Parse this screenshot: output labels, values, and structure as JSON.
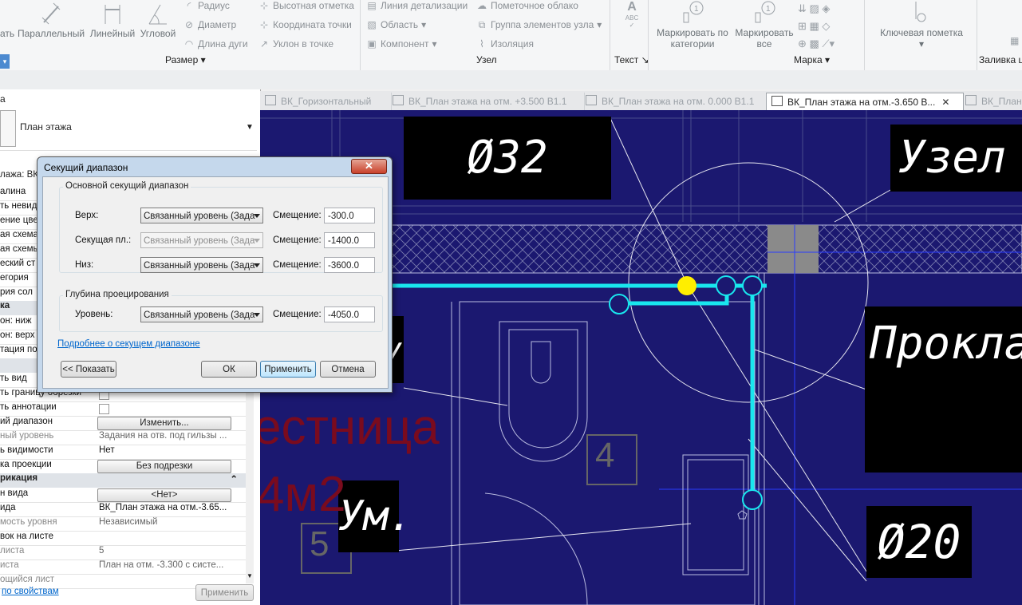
{
  "ribbon": {
    "dim_buttons": [
      {
        "label": "ать"
      },
      {
        "label": "Параллельный"
      },
      {
        "label": "Линейный"
      },
      {
        "label": "Угловой"
      }
    ],
    "dim_small": [
      "Радиус",
      "Диаметр",
      "Длина дуги"
    ],
    "spot_small": [
      "Высотная отметка",
      "Координата точки",
      "Уклон  в точке"
    ],
    "group_dim": "Размер",
    "detail_small": [
      "Линия детализации",
      "Область",
      "Компонент"
    ],
    "detail_small2": [
      "Пометочное облако",
      "Группа элементов узла",
      "Изоляция"
    ],
    "group_detail": "Узел",
    "text_label": "Текст",
    "tag_buttons": [
      "Маркировать по категории",
      "Маркировать все"
    ],
    "group_tag": "Марка",
    "keynote_label": "Ключевая пометка",
    "fill_group": "Заливка ц"
  },
  "left_panel": {
    "header_label": "а",
    "type_name": "План этажа",
    "view_selector": "лажа: ВК_",
    "rows": [
      {
        "k": "алина",
        "v": ""
      },
      {
        "k": "ть невид",
        "v": ""
      },
      {
        "k": "ение цве",
        "v": ""
      },
      {
        "k": "ая схема",
        "v": ""
      },
      {
        "k": "ая схемы",
        "v": ""
      },
      {
        "k": "еский ст",
        "v": ""
      },
      {
        "k": "егория",
        "v": ""
      },
      {
        "k": "рия сол",
        "v": ""
      }
    ],
    "cat1": "ка",
    "rows2": [
      {
        "k": "он: ниж",
        "v": ""
      },
      {
        "k": "он: верх",
        "v": ""
      },
      {
        "k": "тация под",
        "v": ""
      }
    ],
    "cat2": "",
    "rows3": [
      {
        "k": "ть вид",
        "v": ""
      },
      {
        "k": "ть границу обрезки",
        "v": ""
      },
      {
        "k": "ть аннотации",
        "v": ""
      },
      {
        "k": "ий диапазон",
        "v": "Изменить..."
      },
      {
        "k": "ный уровень",
        "v": "Задания на отв. под гильзы ..."
      },
      {
        "k": "ь видимости",
        "v": "Нет"
      },
      {
        "k": "ка проекции",
        "v": "Без подрезки"
      }
    ],
    "cat3": "рикация",
    "rows4": [
      {
        "k": "н вида",
        "v": "<Нет>"
      },
      {
        "k": "ида",
        "v": "ВК_План этажа на отм.-3.65..."
      },
      {
        "k": "мость уровня",
        "v": "Независимый"
      },
      {
        "k": "вок на листе",
        "v": ""
      },
      {
        "k": "листа",
        "v": "5"
      },
      {
        "k": "иста",
        "v": "План на отм. -3.300 с систе..."
      },
      {
        "k": "ощийся лист",
        "v": ""
      }
    ],
    "help_link": "по свойствам",
    "apply_button": "Применить"
  },
  "tabs": [
    {
      "label": "ВК_Горизонтальный",
      "active": false
    },
    {
      "label": "ВК_План этажа на отм. +3.500 В1.1",
      "active": false
    },
    {
      "label": "ВК_План этажа на отм. 0.000 В1.1",
      "active": false
    },
    {
      "label": "ВК_План этажа на отм.-3.650 В...",
      "active": true
    },
    {
      "label": "ВК_План",
      "active": false
    }
  ],
  "canvas": {
    "tag_d32": "Ø32",
    "tag_node": "Узел А",
    "tag_prokl": "Прокладка",
    "tag_d20": "Ø20",
    "tag_um": "Ум.",
    "room_text": "естница",
    "room_area": "4м2",
    "room_num_4": "4",
    "room_num_5": "5",
    "left_tag": "у."
  },
  "dialog": {
    "title": "Секущий диапазон",
    "close_label": "✕",
    "section1": "Основной секущий диапазон",
    "rows": [
      {
        "label": "Верх:",
        "level": "Связанный уровень (Зада",
        "offset_label": "Смещение:",
        "offset": "-300.0",
        "disabled": false
      },
      {
        "label": "Секущая пл.:",
        "level": "Связанный уровень (Зада",
        "offset_label": "Смещение:",
        "offset": "-1400.0",
        "disabled": true
      },
      {
        "label": "Низ:",
        "level": "Связанный уровень (Зада",
        "offset_label": "Смещение:",
        "offset": "-3600.0",
        "disabled": false
      }
    ],
    "section2": "Глубина проецирования",
    "depth": {
      "label": "Уровень:",
      "level": "Связанный уровень (Зада",
      "offset_label": "Смещение:",
      "offset": "-4050.0"
    },
    "link": "Подробнее о секущем диапазоне",
    "btn_show": "<< Показать",
    "btn_ok": "ОК",
    "btn_apply": "Применить",
    "btn_cancel": "Отмена"
  },
  "colors": {
    "canvas_bg": "#1b1870",
    "pipe": "#19e6ee",
    "room_text": "#7a0b1e",
    "accent_yellow": "#ffee00"
  }
}
